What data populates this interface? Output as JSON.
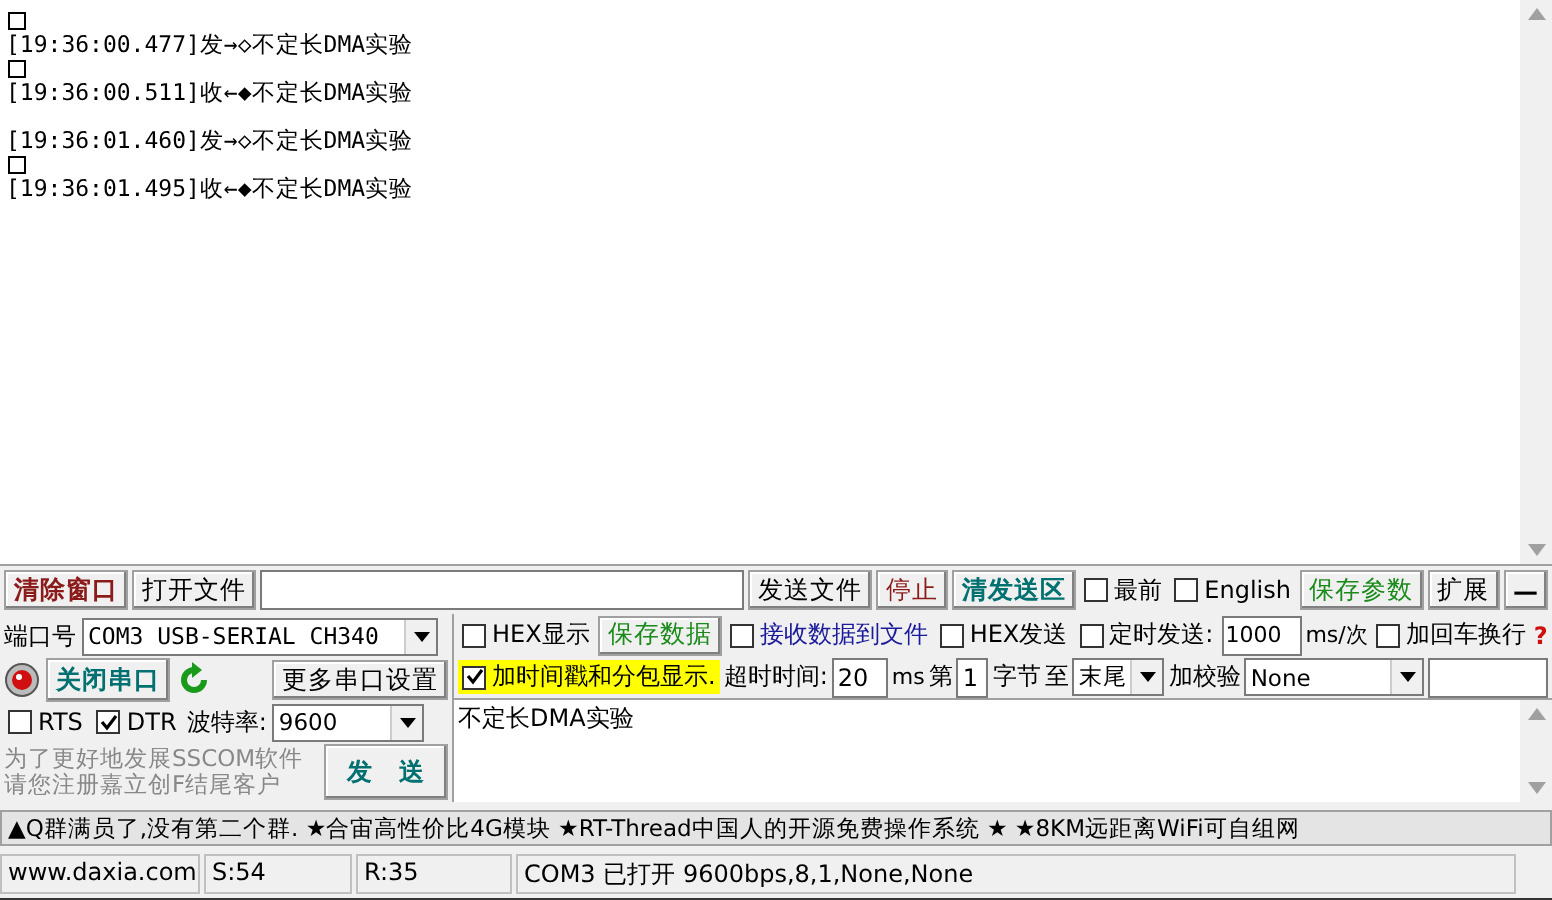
{
  "log": {
    "lines": [
      {
        "kind": "box"
      },
      {
        "kind": "text",
        "text": "[19:36:00.477]发→◇不定长DMA实验"
      },
      {
        "kind": "box"
      },
      {
        "kind": "text",
        "text": "[19:36:00.511]收←◆不定长DMA实验"
      },
      {
        "kind": "gap"
      },
      {
        "kind": "text",
        "text": "[19:36:01.460]发→◇不定长DMA实验"
      },
      {
        "kind": "box"
      },
      {
        "kind": "text",
        "text": "[19:36:01.495]收←◆不定长DMA实验"
      }
    ]
  },
  "toolbar": [
    {
      "kind": "button",
      "label": "清除窗口",
      "color": "#8b1a1a",
      "bold": true
    },
    {
      "kind": "button",
      "label": "打开文件",
      "color": "#000000",
      "bold": false
    },
    {
      "kind": "field"
    },
    {
      "kind": "button",
      "label": "发送文件",
      "color": "#000000",
      "bold": false
    },
    {
      "kind": "button",
      "label": "停止",
      "color": "#8b1a1a",
      "bold": false
    },
    {
      "kind": "button",
      "label": "清发送区",
      "color": "#007070",
      "bold": true
    },
    {
      "kind": "checkbox",
      "label": "最前",
      "checked": false
    },
    {
      "kind": "checkbox",
      "label": "English",
      "checked": false
    },
    {
      "kind": "button",
      "label": "保存参数",
      "color": "#1a8a1a",
      "bold": false
    },
    {
      "kind": "button",
      "label": "扩展",
      "color": "#000000",
      "bold": false
    },
    {
      "kind": "button",
      "label": "—",
      "color": "#000000",
      "bold": true
    }
  ],
  "port": {
    "label": "端口号",
    "value": "COM3 USB-SERIAL CH340",
    "open": true,
    "close_button": "关闭串口",
    "more_button": "更多串口设置",
    "rts": {
      "label": "RTS",
      "checked": false
    },
    "dtr": {
      "label": "DTR",
      "checked": true
    },
    "baud_label": "波特率:",
    "baud": "9600",
    "promo": [
      "为了更好地发展SSCOM软件",
      "请您注册嘉立创F结尾客户"
    ],
    "send_button": "发　送"
  },
  "options": {
    "hex_display": {
      "label": "HEX显示",
      "checked": false
    },
    "save_data": "保存数据",
    "recv_to_file": {
      "label": "接收数据到文件",
      "checked": false
    },
    "hex_send": {
      "label": "HEX发送",
      "checked": false
    },
    "timed_send": {
      "label": "定时发送:",
      "checked": false
    },
    "interval": "1000",
    "interval_unit": "ms/次",
    "crlf": {
      "label": "加回车换行",
      "checked": false
    },
    "help": "?",
    "timestamp": {
      "label": "加时间戳和分包显示.",
      "checked": true
    },
    "timeout_label": "超时时间:",
    "timeout": "20",
    "timeout_unit": "ms",
    "from_label": "第",
    "from": "1",
    "bytes_label": "字节",
    "to_label": "至",
    "to": "末尾",
    "checksum_label": "加校验",
    "checksum": "None"
  },
  "send_text": "不定长DMA实验",
  "marquee": "▲Q群满员了,没有第二个群. ★合宙高性价比4G模块 ★RT-Thread中国人的开源免费操作系统 ★ ★8KM远距离WiFi可自组网",
  "status_bar": [
    "www.daxia.com",
    "S:54",
    "R:35",
    "COM3 已打开  9600bps,8,1,None,None"
  ]
}
